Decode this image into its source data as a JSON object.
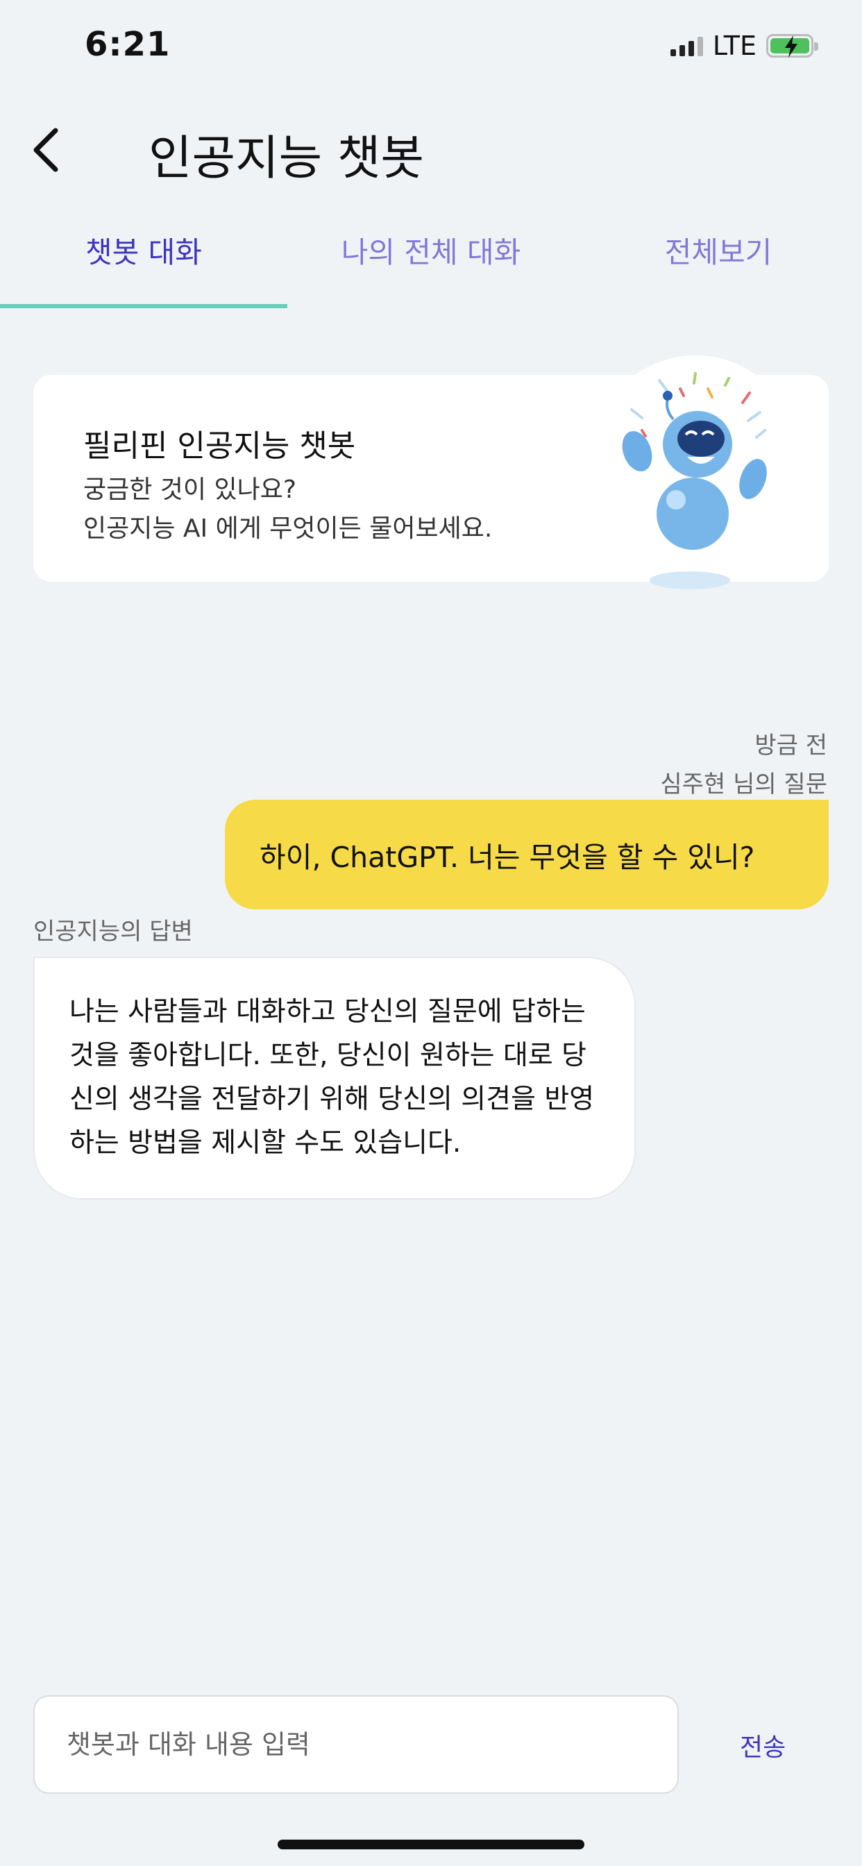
{
  "status_bar": {
    "time": "6:21",
    "network": "LTE",
    "battery_color": "#4fc15c"
  },
  "header": {
    "back_icon": "chevron-left-icon",
    "title": "인공지능 챗봇"
  },
  "tabs": [
    {
      "label": "챗봇 대화",
      "active": true
    },
    {
      "label": "나의 전체 대화",
      "active": false
    },
    {
      "label": "전체보기",
      "active": false
    }
  ],
  "intro_card": {
    "title": "필리핀 인공지능 챗봇",
    "line1": "궁금한 것이 있나요?",
    "line2": "인공지능 AI 에게 무엇이든 물어보세요.",
    "illustration": "robot-mascot-icon"
  },
  "conversation": {
    "question_time": "방금 전",
    "question_author": "심주현 님의 질문",
    "question_text": "하이, ChatGPT. 너는 무엇을 할 수 있니?",
    "answer_label": "인공지능의 답변",
    "answer_lines": [
      "나는 사람들과 대화하고 당신의 질문에 답하는",
      "것을 좋아합니다. 또한, 당신이 원하는 대로 당",
      "신의 생각을 전달하기 위해 당신의 의견을 반영",
      "하는 방법을 제시할 수도 있습니다."
    ]
  },
  "composer": {
    "placeholder": "챗봇과 대화 내용 입력",
    "send_label": "전송"
  },
  "colors": {
    "accent": "#3f34bf",
    "tab_indicator": "#69cdb9",
    "user_bubble": "#f6da48",
    "background": "#f0f3f6"
  }
}
